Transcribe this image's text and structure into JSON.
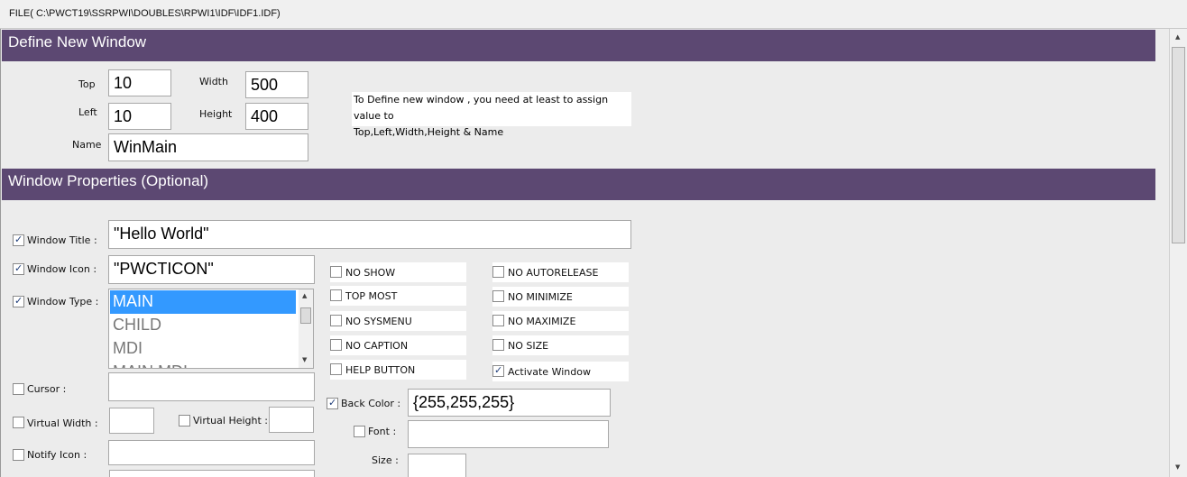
{
  "window": {
    "path": "FILE( C:\\PWCT19\\SSRPWI\\DOUBLES\\RPWI1\\IDF\\IDF1.IDF)"
  },
  "define_section": {
    "header": "Define New Window",
    "top_label": "Top",
    "top_value": "10",
    "left_label": "Left",
    "left_value": "10",
    "width_label": "Width",
    "width_value": "500",
    "height_label": "Height",
    "height_value": "400",
    "name_label": "Name",
    "name_value": "WinMain",
    "note_line1": "To Define new window , you need at least to assign value to",
    "note_line2": "Top,Left,Width,Height & Name"
  },
  "props_section": {
    "header": "Window Properties (Optional)",
    "window_title_label": "Window Title :",
    "window_title_value": "\"Hello World\"",
    "window_icon_label": "Window Icon :",
    "window_icon_value": "\"PWCTICON\"",
    "window_type_label": "Window Type :",
    "window_type_options": [
      "MAIN",
      "CHILD",
      "MDI",
      "MAIN MDI"
    ],
    "window_type_selected": "MAIN",
    "cursor_label": "Cursor :",
    "virtual_width_label": "Virtual Width :",
    "virtual_height_label": "Virtual Height :",
    "notify_icon_label": "Notify Icon :",
    "options": {
      "no_show": "NO SHOW",
      "top_most": "TOP MOST",
      "no_sysmenu": "NO SYSMENU",
      "no_caption": "NO CAPTION",
      "help_button": "HELP BUTTON",
      "no_autorelease": "NO AUTORELEASE",
      "no_minimize": "NO MINIMIZE",
      "no_maximize": "NO MAXIMIZE",
      "no_size": "NO SIZE",
      "activate_window": "Activate Window"
    },
    "back_color_label": "Back Color :",
    "back_color_value": "{255,255,255}",
    "font_label": "Font :",
    "size_label": "Size :"
  },
  "colors": {
    "header_bg": "#5c4872",
    "selection": "#3399ff"
  }
}
